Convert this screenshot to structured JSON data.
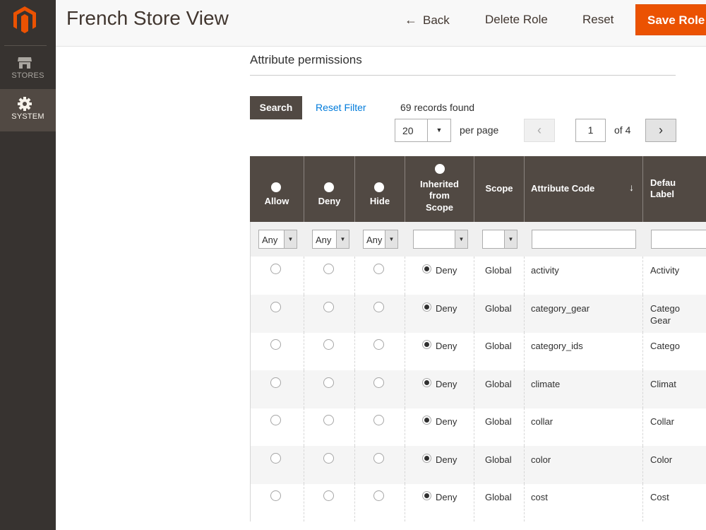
{
  "nav": {
    "stores_label": "STORES",
    "system_label": "SYSTEM"
  },
  "header": {
    "title": "French Store View",
    "back_label": "Back",
    "delete_label": "Delete Role",
    "reset_label": "Reset",
    "save_label": "Save Role"
  },
  "section": {
    "title": "Attribute permissions",
    "search_label": "Search",
    "reset_filter_label": "Reset Filter",
    "records_found": "69 records found",
    "per_page_value": "20",
    "per_page_label": "per page",
    "page_current": "1",
    "page_of": "of 4"
  },
  "grid": {
    "columns": {
      "allow": "Allow",
      "deny": "Deny",
      "hide": "Hide",
      "inherited_l1": "Inherited",
      "inherited_l2": "from",
      "inherited_l3": "Scope",
      "scope": "Scope",
      "attribute_code": "Attribute Code",
      "sort_indicator": "↓",
      "default_label_l1": "Defau",
      "default_label_l2": "Label"
    },
    "filters": {
      "allow": "Any",
      "deny": "Any",
      "hide": "Any",
      "inherited": "",
      "scope": ""
    },
    "rows": [
      {
        "inherited": "Deny",
        "scope": "Global",
        "code": "activity",
        "label_l1": "Activity",
        "label_l2": ""
      },
      {
        "inherited": "Deny",
        "scope": "Global",
        "code": "category_gear",
        "label_l1": "Catego",
        "label_l2": "Gear"
      },
      {
        "inherited": "Deny",
        "scope": "Global",
        "code": "category_ids",
        "label_l1": "Catego",
        "label_l2": ""
      },
      {
        "inherited": "Deny",
        "scope": "Global",
        "code": "climate",
        "label_l1": "Climat",
        "label_l2": ""
      },
      {
        "inherited": "Deny",
        "scope": "Global",
        "code": "collar",
        "label_l1": "Collar",
        "label_l2": ""
      },
      {
        "inherited": "Deny",
        "scope": "Global",
        "code": "color",
        "label_l1": "Color",
        "label_l2": ""
      },
      {
        "inherited": "Deny",
        "scope": "Global",
        "code": "cost",
        "label_l1": "Cost",
        "label_l2": ""
      }
    ]
  },
  "colors": {
    "sidebar": "#373330",
    "accent": "#eb5202",
    "grid_header": "#514943",
    "link": "#007bdb"
  }
}
